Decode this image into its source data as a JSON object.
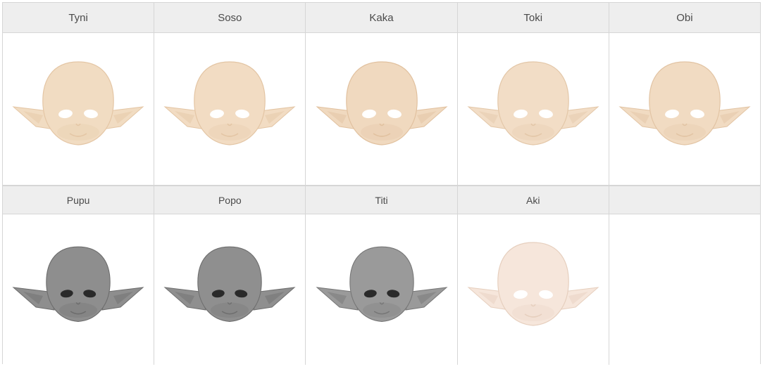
{
  "rows": [
    {
      "cells": [
        {
          "name": "Tyni",
          "color": "#f1dcc2",
          "shade": "#e4c6a5"
        },
        {
          "name": "Soso",
          "color": "#f2dcc3",
          "shade": "#e3c5a4"
        },
        {
          "name": "Kaka",
          "color": "#f0d9bf",
          "shade": "#e1c19f"
        },
        {
          "name": "Toki",
          "color": "#f2ddc6",
          "shade": "#e3c7a8"
        },
        {
          "name": "Obi",
          "color": "#f1dbc2",
          "shade": "#e2c4a4"
        }
      ]
    },
    {
      "cells": [
        {
          "name": "Pupu",
          "color": "#8e8e8e",
          "shade": "#6c6c6c"
        },
        {
          "name": "Popo",
          "color": "#8f8f8f",
          "shade": "#6e6e6e"
        },
        {
          "name": "Titi",
          "color": "#9a9a9a",
          "shade": "#767676"
        },
        {
          "name": "Aki",
          "color": "#f6e6db",
          "shade": "#e6cfbe"
        },
        {
          "name": "",
          "color": "",
          "shade": ""
        }
      ]
    }
  ]
}
